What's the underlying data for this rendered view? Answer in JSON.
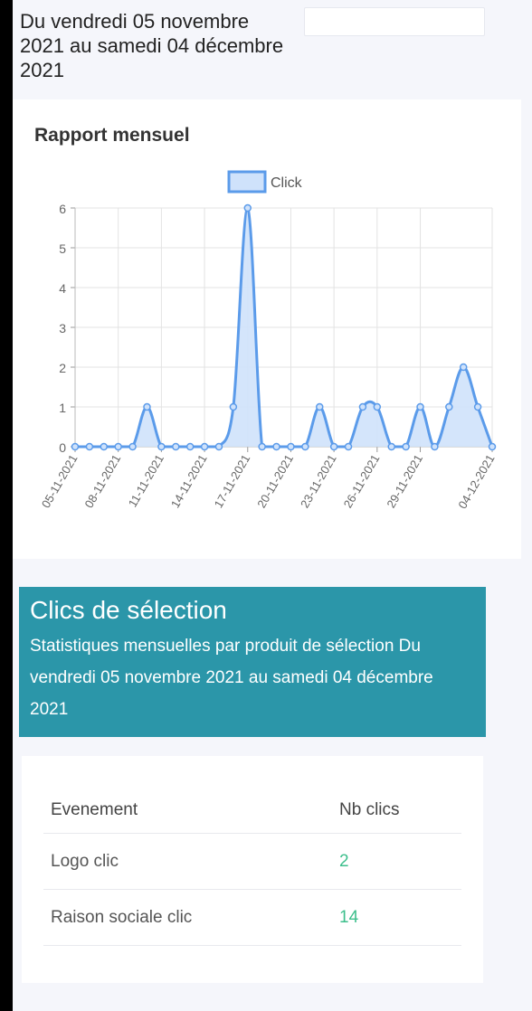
{
  "header": {
    "date_range": "Du vendredi 05 novembre 2021 au samedi 04 décembre 2021"
  },
  "chart_card": {
    "title": "Rapport mensuel"
  },
  "chart_data": {
    "type": "area",
    "legend": [
      "Click"
    ],
    "legend_placement": "top",
    "x_tick_labels": [
      "05-11-2021",
      "08-11-2021",
      "11-11-2021",
      "14-11-2021",
      "17-11-2021",
      "20-11-2021",
      "23-11-2021",
      "26-11-2021",
      "29-11-2021",
      "04-12-2021"
    ],
    "y_tick_labels": [
      "0",
      "1",
      "2",
      "3",
      "4",
      "5",
      "6"
    ],
    "ylim": [
      0,
      6
    ],
    "grid": true,
    "series": [
      {
        "name": "Click",
        "color": "#5b9bea",
        "fill": "#cfe2fb",
        "x": [
          "05-11-2021",
          "06-11-2021",
          "07-11-2021",
          "08-11-2021",
          "09-11-2021",
          "10-11-2021",
          "11-11-2021",
          "12-11-2021",
          "13-11-2021",
          "14-11-2021",
          "15-11-2021",
          "16-11-2021",
          "17-11-2021",
          "18-11-2021",
          "19-11-2021",
          "20-11-2021",
          "21-11-2021",
          "22-11-2021",
          "23-11-2021",
          "24-11-2021",
          "25-11-2021",
          "26-11-2021",
          "27-11-2021",
          "28-11-2021",
          "29-11-2021",
          "30-11-2021",
          "01-12-2021",
          "02-12-2021",
          "03-12-2021",
          "04-12-2021"
        ],
        "values": [
          0,
          0,
          0,
          0,
          0,
          1,
          0,
          0,
          0,
          0,
          0,
          1,
          6,
          0,
          0,
          0,
          0,
          1,
          0,
          0,
          1,
          1,
          0,
          0,
          1,
          0,
          1,
          2,
          1,
          0
        ]
      }
    ]
  },
  "selection": {
    "title": "Clics de sélection",
    "subtitle": "Statistiques mensuelles par produit de sélection Du vendredi 05 novembre 2021 au samedi 04 décembre 2021"
  },
  "table": {
    "headers": [
      "Evenement",
      "Nb clics"
    ],
    "rows": [
      {
        "event": "Logo clic",
        "count": "2"
      },
      {
        "event": "Raison sociale clic",
        "count": "14"
      }
    ]
  }
}
